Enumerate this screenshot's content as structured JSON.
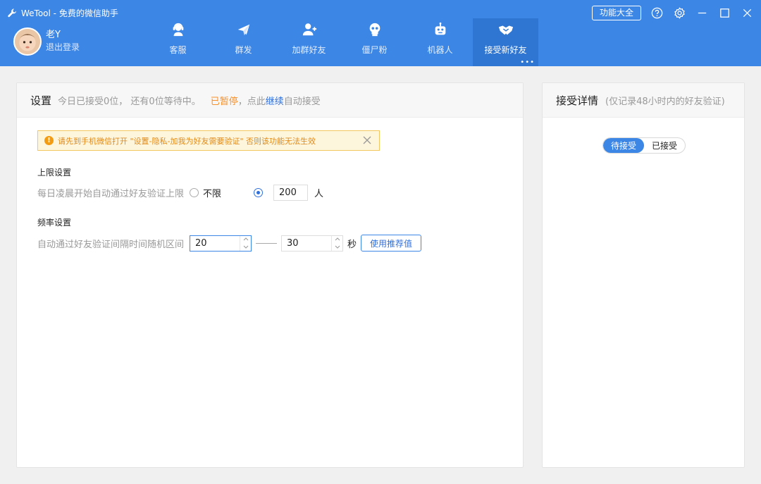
{
  "app": {
    "title": "WeTool - 免费的微信助手"
  },
  "user": {
    "name": "老Y",
    "logout": "退出登录"
  },
  "nav": [
    {
      "label": "客服",
      "icon": "customer-service-icon"
    },
    {
      "label": "群发",
      "icon": "paper-plane-icon"
    },
    {
      "label": "加群好友",
      "icon": "add-user-icon"
    },
    {
      "label": "僵尸粉",
      "icon": "skull-icon"
    },
    {
      "label": "机器人",
      "icon": "robot-icon"
    },
    {
      "label": "接受新好友",
      "icon": "handshake-icon",
      "active": true
    }
  ],
  "header": {
    "func_button": "功能大全"
  },
  "settings": {
    "title": "设置",
    "status_prefix": "今日已接受0位， 还有0位等待中。",
    "status_paused": "已暂停",
    "status_mid": "，点此",
    "status_link": "继续",
    "status_suffix": "自动接受",
    "notice": "请先到手机微信打开 \"设置-隐私-加我为好友需要验证\" 否则该功能无法生效",
    "limit_title": "上限设置",
    "limit_label": "每日凌晨开始自动通过好友验证上限",
    "limit_unlimited": "不限",
    "limit_value": "200",
    "limit_unit": "人",
    "freq_title": "频率设置",
    "freq_label": "自动通过好友验证间隔时间随机区间",
    "freq_min": "20",
    "freq_max": "30",
    "freq_unit": "秒",
    "recommend_button": "使用推荐值"
  },
  "details": {
    "title": "接受详情",
    "subtitle": "(仅记录48小时内的好友验证)",
    "tab_pending": "待接受",
    "tab_accepted": "已接受"
  },
  "colors": {
    "header": "#3c86e6",
    "active_tab": "#2f76d3",
    "paused": "#f5902a",
    "link": "#2f6fdc"
  }
}
